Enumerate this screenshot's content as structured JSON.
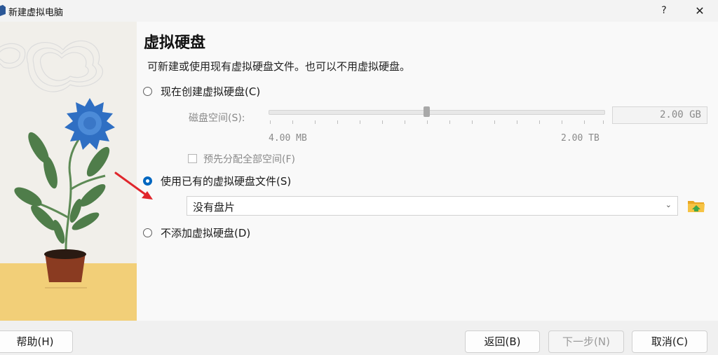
{
  "window": {
    "title": "新建虚拟电脑",
    "help_label": "?",
    "close_label": "✕"
  },
  "page": {
    "title": "虚拟硬盘",
    "subtitle": "可新建或使用现有虚拟硬盘文件。也可以不用虚拟硬盘。"
  },
  "options": {
    "create_now": {
      "label": "现在创建虚拟硬盘(C)",
      "selected": false
    },
    "use_existing": {
      "label": "使用已有的虚拟硬盘文件(S)",
      "selected": true
    },
    "no_disk": {
      "label": "不添加虚拟硬盘(D)",
      "selected": false
    }
  },
  "disk_size": {
    "label": "磁盘空间(S):",
    "value": "2.00 GB",
    "min_label": "4.00 MB",
    "max_label": "2.00 TB",
    "enabled": false
  },
  "preallocate": {
    "label": "预先分配全部空间(F)",
    "checked": false,
    "enabled": false
  },
  "existing_file": {
    "selected_value": "没有盘片",
    "dropdown_icon": "chevron-down-icon",
    "browse_icon": "folder-icon"
  },
  "buttons": {
    "help": "帮助(H)",
    "back": "返回(B)",
    "next": "下一步(N)",
    "cancel": "取消(C)"
  },
  "colors": {
    "accent": "#0067c0",
    "annotation_arrow": "#e0262c"
  }
}
